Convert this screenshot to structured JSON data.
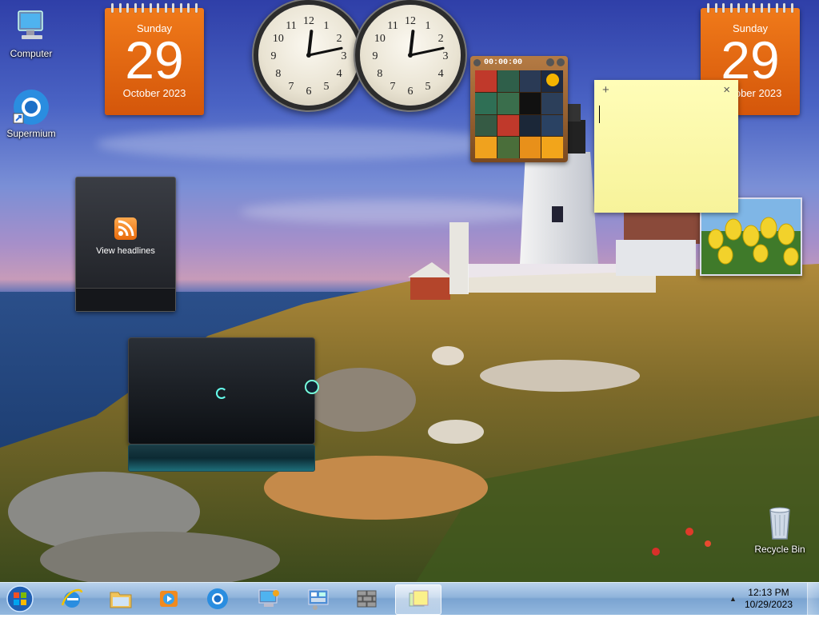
{
  "desktop": {
    "icons": [
      {
        "label": "Computer"
      },
      {
        "label": "Supermium"
      },
      {
        "label": "Recycle Bin"
      }
    ]
  },
  "calendar_left": {
    "weekday": "Sunday",
    "day": "29",
    "month_year": "October 2023"
  },
  "calendar_right": {
    "weekday": "Sunday",
    "day": "29",
    "month_year": "October 2023"
  },
  "clocks": [
    {
      "hour": 12,
      "minute": 13
    },
    {
      "hour": 12,
      "minute": 13
    }
  ],
  "puzzle": {
    "timer": "00:00:00"
  },
  "note": {
    "add": "+",
    "close": "×",
    "text": ""
  },
  "feed": {
    "label": "View headlines"
  },
  "taskbar": {
    "items": [
      "Internet Explorer",
      "Windows Explorer",
      "Windows Media Player",
      "Supermium",
      "Computer",
      "Control Panel",
      "Firewall",
      "Sticky Notes"
    ],
    "active_item": "Sticky Notes",
    "tray": {
      "arrow": "▲",
      "time": "12:13 PM",
      "date": "10/29/2023"
    }
  },
  "colors": {
    "accent": "#f07a1a",
    "taskbar": "#8fb3db"
  }
}
